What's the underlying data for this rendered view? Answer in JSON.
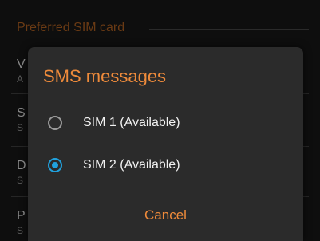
{
  "background": {
    "section_header": "Preferred SIM card",
    "items": [
      {
        "title": "V",
        "sub": "A"
      },
      {
        "title": "S",
        "sub": "S"
      },
      {
        "title": "D",
        "sub": "S"
      },
      {
        "title": "P",
        "sub": "S"
      }
    ]
  },
  "dialog": {
    "title": "SMS messages",
    "options": [
      {
        "label": "SIM 1 (Available)",
        "checked": false
      },
      {
        "label": "SIM 2 (Available)",
        "checked": true
      }
    ],
    "cancel_label": "Cancel"
  },
  "colors": {
    "accent": "#ef8b3b",
    "radio_selected": "#21a1dd",
    "dialog_bg": "#2b2b2b"
  }
}
